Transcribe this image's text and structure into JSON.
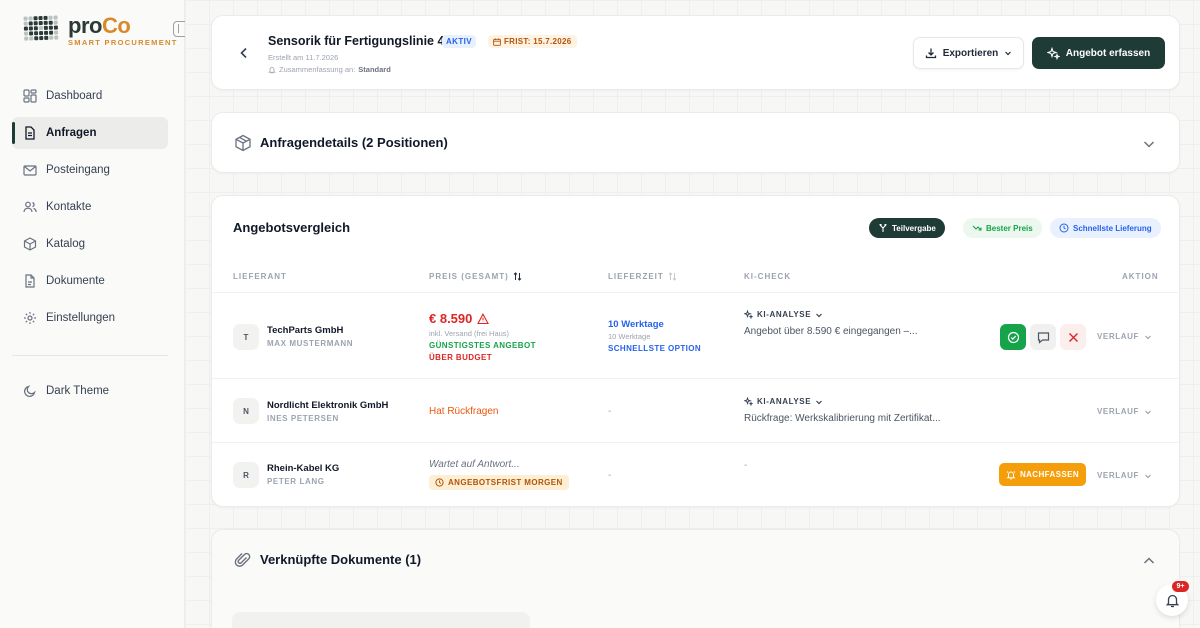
{
  "brand": {
    "name_a": "pro",
    "name_b": "Co",
    "subtitle": "SMART PROCUREMENT"
  },
  "nav": {
    "items": [
      {
        "label": "Dashboard",
        "icon": "dashboard-icon"
      },
      {
        "label": "Anfragen",
        "icon": "file-icon",
        "active": true
      },
      {
        "label": "Posteingang",
        "icon": "mail-icon"
      },
      {
        "label": "Kontakte",
        "icon": "users-icon"
      },
      {
        "label": "Katalog",
        "icon": "box-icon"
      },
      {
        "label": "Dokumente",
        "icon": "document-icon"
      },
      {
        "label": "Einstellungen",
        "icon": "gear-icon"
      }
    ],
    "theme_label": "Dark Theme"
  },
  "header": {
    "title": "Sensorik für Fertigungslinie 4",
    "status": "AKTIV",
    "deadline": "FRIST: 15.7.2026",
    "created": "Erstellt am 11.7.2026",
    "summary_label": "Zusammenfassung an:",
    "summary_value": "Standard",
    "export_label": "Exportieren",
    "primary_label": "Angebot erfassen"
  },
  "details": {
    "title": "Anfragendetails (2 Positionen)"
  },
  "comparison": {
    "title": "Angebotsvergleich",
    "filters": [
      "Teilvergabe",
      "Bester Preis",
      "Schnellste Lieferung"
    ],
    "columns": {
      "supplier": "LIEFERANT",
      "price": "PREIS (GESAMT)",
      "delivery": "LIEFERZEIT",
      "ki": "KI-CHECK",
      "action": "AKTION"
    },
    "rows": [
      {
        "initial": "T",
        "name": "TechParts GmbH",
        "contact": "MAX MUSTERMANN",
        "price": "€ 8.590",
        "price_note": "inkl. Versand (frei Haus)",
        "price_tag1": "GÜNSTIGSTES ANGEBOT",
        "price_tag2": "ÜBER BUDGET",
        "delivery": "10 Werktage",
        "delivery_note": "10 Werktage",
        "delivery_tag": "SCHNELLSTE OPTION",
        "ki_label": "KI-ANALYSE",
        "ki_text": "Angebot über 8.590 € eingegangen –...",
        "verlauf": "VERLAUF"
      },
      {
        "initial": "N",
        "name": "Nordlicht Elektronik GmbH",
        "contact": "INES PETERSEN",
        "price_status": "Hat Rückfragen",
        "delivery": "-",
        "ki_label": "KI-ANALYSE",
        "ki_text": "Rückfrage: Werkskalibrierung mit Zertifikat...",
        "verlauf": "VERLAUF"
      },
      {
        "initial": "R",
        "name": "Rhein-Kabel KG",
        "contact": "PETER LANG",
        "price_status": "Wartet auf Antwort...",
        "price_badge": "ANGEBOTSFRIST MORGEN",
        "delivery": "-",
        "ki_text": "-",
        "action_label": "NACHFASSEN",
        "verlauf": "VERLAUF"
      }
    ]
  },
  "documents": {
    "title": "Verknüpfte Dokumente (1)"
  },
  "notifications": {
    "count": "9+"
  },
  "colors": {
    "brand_dark": "#1f3b36",
    "brand_orange": "#d88a2a",
    "danger": "#dc2626",
    "success": "#16a34a",
    "info": "#2563eb",
    "warning": "#f59e0b"
  }
}
